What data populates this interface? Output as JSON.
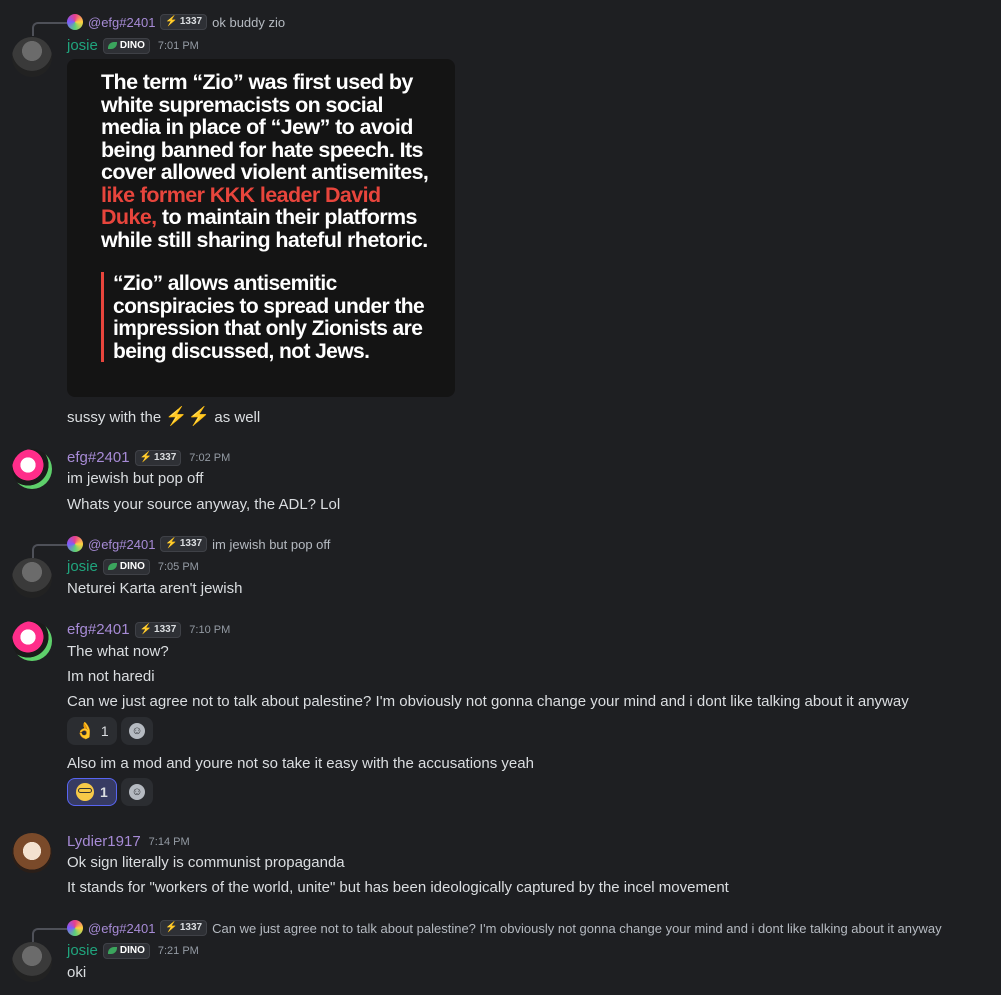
{
  "users": {
    "josie": "josie",
    "efg": "efg#2401",
    "efg_mention": "@efg#2401",
    "lydier": "Lydier1917"
  },
  "badges": {
    "efg_badge": "1337",
    "josie_badge": "DINO",
    "bolt_glyph": "⚡"
  },
  "messages": {
    "m1": {
      "reply_text": "ok buddy zio",
      "time": "7:01 PM",
      "image_text_1": "The term “Zio” was first used by white supremacists on social media in place of “Jew” to avoid being banned for hate speech. Its cover allowed violent antisemites,",
      "image_text_red": "like former KKK leader David Duke,",
      "image_text_2": " to maintain their platforms while still sharing hateful rhetoric.",
      "image_quote": "“Zio” allows antisemitic conspiracies to spread under the impression that only Zionists are being discussed, not Jews.",
      "text_before": "sussy with the ",
      "text_emoji": "⚡⚡",
      "text_after": " as well"
    },
    "m2": {
      "time": "7:02 PM",
      "line1": "im jewish but pop off",
      "line2": "Whats your source anyway, the ADL? Lol"
    },
    "m3": {
      "reply_text": "im jewish but pop off",
      "time": "7:05 PM",
      "line1": "Neturei Karta aren't jewish"
    },
    "m4": {
      "time": "7:10 PM",
      "line1": "The what now?",
      "line2": "Im not haredi",
      "line3": "Can we just agree not to talk about palestine? I'm obviously not gonna change your mind and i dont like talking about it anyway",
      "reaction1_emoji": "👌",
      "reaction1_count": "1",
      "line4": "Also im a mod and youre not so take it easy with the accusations yeah",
      "reaction2_count": "1"
    },
    "m5": {
      "time": "7:14 PM",
      "line1": "Ok sign literally is communist propaganda",
      "line2": "It stands for \"workers of the world, unite\" but has been ideologically captured by the incel movement"
    },
    "m6": {
      "reply_text": "Can we just agree not to talk about palestine? I'm obviously not gonna change your mind and i dont like talking about it anyway",
      "time": "7:21 PM",
      "line1": "oki"
    }
  }
}
